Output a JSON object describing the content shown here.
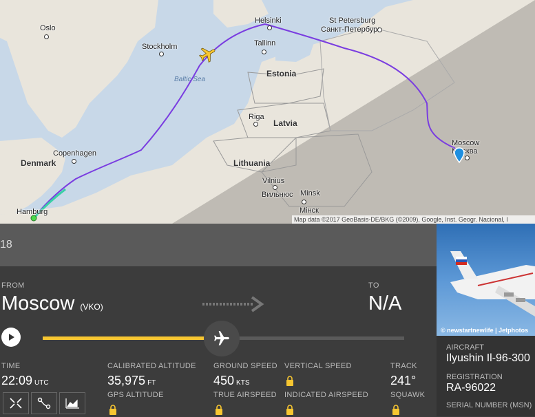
{
  "map": {
    "cities": {
      "oslo": "Oslo",
      "stockholm": "Stockholm",
      "helsinki": "Helsinki",
      "st_petersburg": "St Petersburg",
      "st_petersburg_ru": "Санкт-Петербург",
      "tallinn": "Tallinn",
      "riga": "Riga",
      "copenhagen": "Copenhagen",
      "vilnius": "Vilnius",
      "vilnius_ru": "Вильнюс",
      "minsk": "Minsk",
      "minsk_ru": "Мінск",
      "moscow": "Moscow",
      "moscow_ru": "Москва",
      "hamburg": "Hamburg"
    },
    "countries": {
      "estonia": "Estonia",
      "latvia": "Latvia",
      "lithuania": "Lithuania",
      "denmark": "Denmark"
    },
    "sea": "Baltic Sea",
    "attribution": "Map data ©2017 GeoBasis-DE/BKG (©2009), Google, Inst. Geogr. Nacional, I"
  },
  "flight": {
    "id_partial": "18",
    "from_label": "FROM",
    "from_city": "Moscow",
    "from_code": "(VKO)",
    "to_label": "TO",
    "to_value": "N/A",
    "progress_percent": 51
  },
  "stats": {
    "time_label": "TIME",
    "time_value": "22:09",
    "time_unit": "UTC",
    "cal_alt_label": "CALIBRATED ALTITUDE",
    "cal_alt_value": "35,975",
    "cal_alt_unit": "FT",
    "gps_alt_label": "GPS ALTITUDE",
    "ground_speed_label": "GROUND SPEED",
    "ground_speed_value": "450",
    "ground_speed_unit": "KTS",
    "true_airspeed_label": "TRUE AIRSPEED",
    "vertical_speed_label": "VERTICAL SPEED",
    "indicated_airspeed_label": "INDICATED AIRSPEED",
    "track_label": "TRACK",
    "track_value": "241°",
    "squawk_label": "SQUAWK"
  },
  "aircraft": {
    "photo_credit": "© newstartnewlife | Jetphotos",
    "aircraft_label": "AIRCRAFT",
    "aircraft_value": "Ilyushin Il-96-300",
    "registration_label": "REGISTRATION",
    "registration_value": "RA-96022",
    "serial_label": "SERIAL NUMBER (MSN)"
  },
  "colors": {
    "progress": "#f7c631",
    "route": "#7a3de0",
    "aircraft_icon": "#f7c631"
  },
  "icons": [
    "play-icon",
    "arrow-right-icon",
    "airplane-icon",
    "lock-icon",
    "collapse-icon",
    "route-icon",
    "chart-icon"
  ]
}
